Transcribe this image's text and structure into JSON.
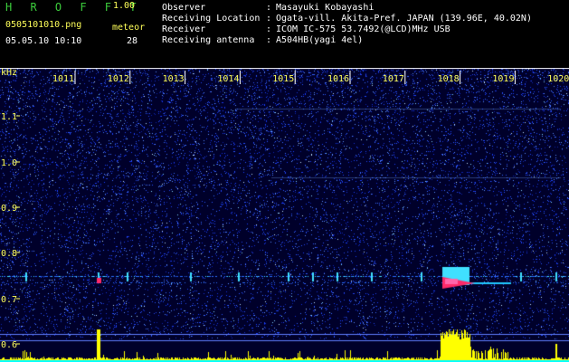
{
  "header": {
    "app_name": "H R O F F T",
    "version": "1.00",
    "filename": "0505101010.png",
    "datetime": "05.05.10 10:10",
    "meteor_label": "meteor",
    "meteor_count": "28"
  },
  "info": [
    {
      "key": "Observer",
      "colon": ":",
      "value": "Masayuki Kobayashi"
    },
    {
      "key": "Receiving Location",
      "colon": ":",
      "value": "Ogata-vill. Akita-Pref. JAPAN (139.96E, 40.02N)"
    },
    {
      "key": "Receiver",
      "colon": ":",
      "value": "ICOM IC-575 53.7492(@LCD)MHz USB"
    },
    {
      "key": "Receiving antenna",
      "colon": ":",
      "value": "A504HB(yagi 4el)"
    }
  ],
  "plot": {
    "y_unit": "kHz",
    "y_ticks": [
      "1.1",
      "1.0",
      "0.9",
      "0.8",
      "0.7",
      "0.6"
    ],
    "x_ticks": [
      "1011",
      "1012",
      "1013",
      "1014",
      "1015",
      "1016",
      "1017",
      "1018",
      "1019",
      "1020"
    ],
    "colors": {
      "background": "#00002a",
      "noise": "#1a3fff",
      "meteor_echo": "#ff2a6a",
      "signal_bar": "#ffff00",
      "baseline": "#00ffff",
      "text": "#ffff5a"
    }
  }
}
